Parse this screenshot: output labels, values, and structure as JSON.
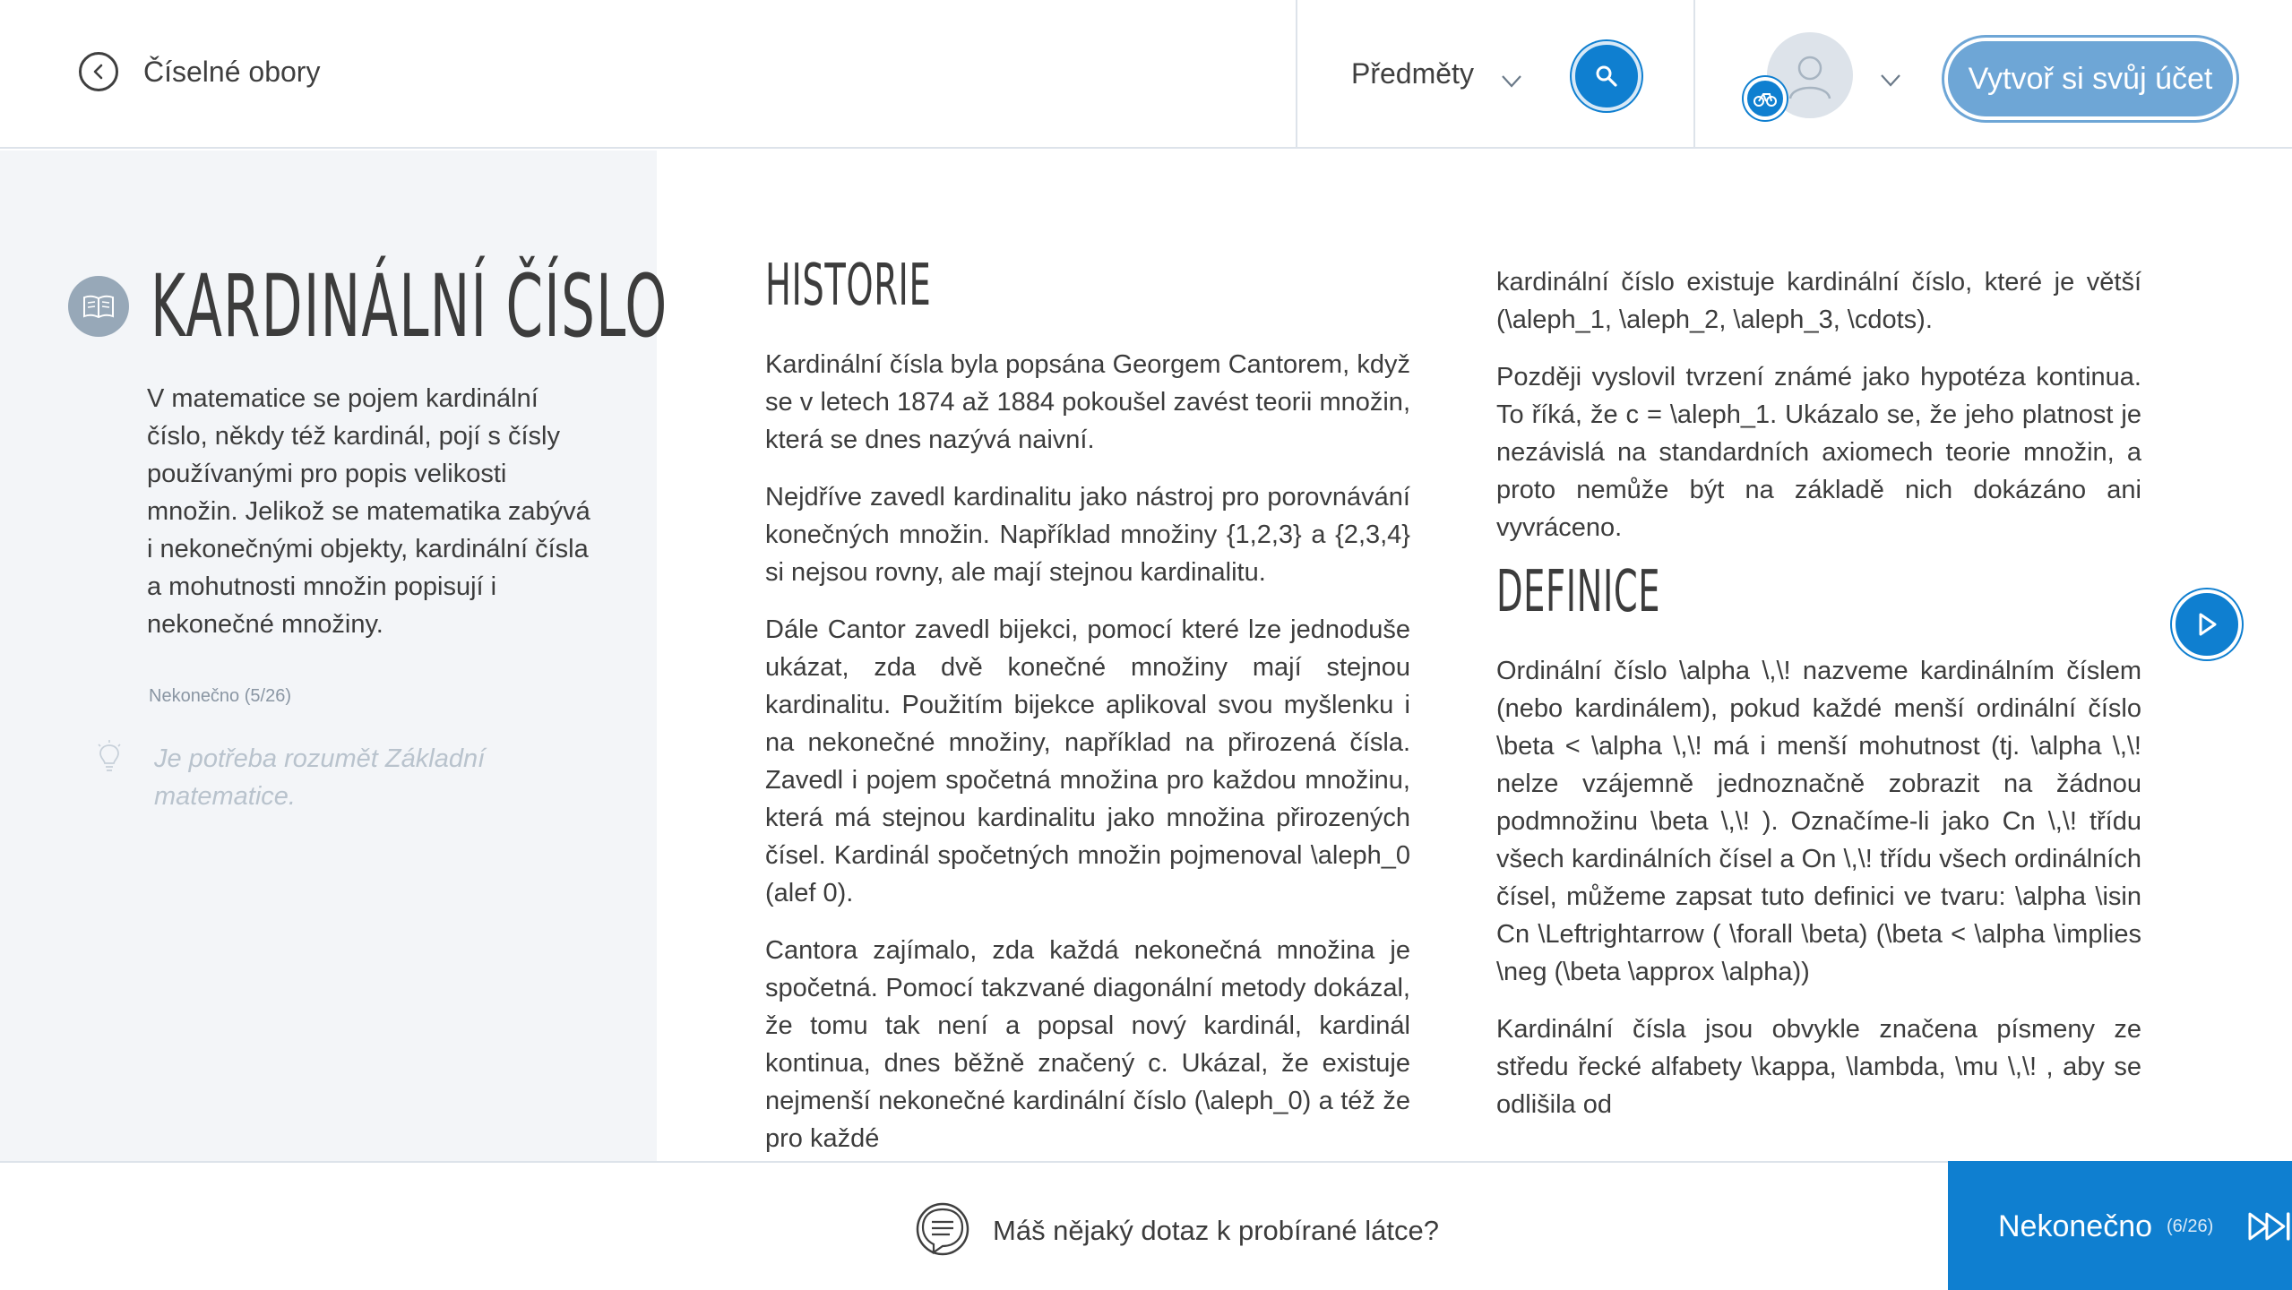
{
  "header": {
    "back_label": "Číselné obory",
    "subjects_label": "Předměty",
    "create_account_label": "Vytvoř si svůj účet",
    "accent_color": "#0f7fd0"
  },
  "lesson": {
    "title": "KARDINÁLNÍ ČÍSLO",
    "intro": "V matematice se pojem kardinální číslo, někdy též kardinál, pojí s čísly používanými pro popis velikosti množin. Jelikož se matematika zabývá i nekonečnými objekty, kardinální čísla a mohutnosti množin popisují i nekonečné množiny.",
    "topic_progress": "Nekonečno (5/26)",
    "prerequisite_hint": "Je potřeba rozumět Základní matematice."
  },
  "content": {
    "historie_title": "HISTORIE",
    "historie_p1": "Kardinální čísla byla popsána Georgem Cantorem, když se v letech 1874 až 1884 pokoušel zavést teorii množin, která se dnes nazývá naivní.",
    "historie_p2": "Nejdříve zavedl kardinalitu jako nástroj pro porovnávání konečných množin. Například množiny {1,2,3} a {2,3,4} si nejsou rovny, ale mají stejnou kardinalitu.",
    "historie_p3": "Dále Cantor zavedl bijekci, pomocí které lze jednoduše ukázat, zda dvě konečné množiny mají stejnou kardinalitu. Použitím bijekce aplikoval svou myšlenku i na nekonečné množiny, například na přirozená čísla. Zavedl i pojem spočetná množina pro každou množinu, která má stejnou kardinalitu jako množina přirozených čísel. Kardinál spočetných množin pojmenoval \\aleph_0 (alef 0).",
    "historie_p4": "Cantora zajímalo, zda každá nekonečná množina je spočetná. Pomocí takzvané diagonální metody dokázal, že tomu tak není a popsal nový kardinál, kardinál kontinua, dnes běžně značený c. Ukázal, že existuje nejmenší nekonečné kardinální číslo (\\aleph_0) a též že pro každé",
    "col2_p1": "kardinální číslo existuje kardinální číslo, které je větší (\\aleph_1, \\aleph_2, \\aleph_3, \\cdots).",
    "col2_p2": "Později vyslovil tvrzení známé jako hypotéza kontinua. To říká, že c = \\aleph_1. Ukázalo se, že jeho platnost je nezávislá na standardních axiomech teorie množin, a proto nemůže být na základě nich dokázáno ani vyvráceno.",
    "definice_title": "DEFINICE",
    "definice_p1": "Ordinální číslo  \\alpha \\,\\!  nazveme kardinálním číslem (nebo kardinálem), pokud každé menší ordinální číslo \\beta < \\alpha \\,\\!  má i menší mohutnost (tj.  \\alpha \\,\\!  nelze vzájemně jednoznačně zobrazit na žádnou podmnožinu \\beta \\,\\! ). Označíme-li jako  Cn \\,\\!  třídu všech kardinálních čísel a  On \\,\\!  třídu všech ordinálních čísel, můžeme zapsat tuto definici ve tvaru:   \\alpha \\isin Cn \\Leftrightarrow ( \\forall \\beta) (\\beta < \\alpha \\implies \\neg (\\beta \\approx \\alpha))",
    "definice_p2": "Kardinální čísla jsou obvykle značena písmeny ze středu řecké alfabety  \\kappa, \\lambda, \\mu \\,\\! , aby se odlišila od"
  },
  "footer": {
    "ask_label": "Máš nějaký dotaz k probírané látce?",
    "next_label": "Nekonečno",
    "next_count": "(6/26)"
  }
}
